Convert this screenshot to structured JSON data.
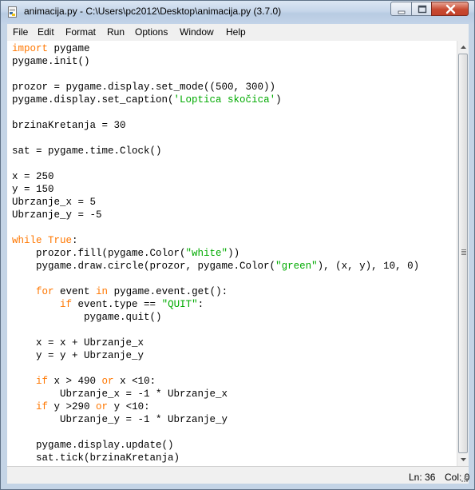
{
  "window": {
    "title": "animacija.py - C:\\Users\\pc2012\\Desktop\\animacija.py (3.7.0)",
    "icon": "python-file-icon"
  },
  "menu": {
    "items": [
      "File",
      "Edit",
      "Format",
      "Run",
      "Options",
      "Window",
      "Help"
    ]
  },
  "status": {
    "line": "Ln: 36",
    "col": "Col: 0"
  },
  "colors": {
    "keyword": "#ff7700",
    "builtin": "#900090",
    "string": "#00aa00",
    "text": "#000000"
  },
  "code": {
    "lines": [
      [
        [
          "kw",
          "import"
        ],
        [
          "t",
          " pygame"
        ]
      ],
      [
        [
          "t",
          "pygame.init()"
        ]
      ],
      [],
      [
        [
          "t",
          "prozor = pygame.display.set_mode((500, 300))"
        ]
      ],
      [
        [
          "t",
          "pygame.display.set_caption("
        ],
        [
          "str",
          "'Loptica skočica'"
        ],
        [
          "t",
          ")"
        ]
      ],
      [],
      [
        [
          "t",
          "brzinaKretanja = 30"
        ]
      ],
      [],
      [
        [
          "t",
          "sat = pygame.time.Clock()"
        ]
      ],
      [],
      [
        [
          "t",
          "x = 250"
        ]
      ],
      [
        [
          "t",
          "y = 150"
        ]
      ],
      [
        [
          "t",
          "Ubrzanje_x = 5"
        ]
      ],
      [
        [
          "t",
          "Ubrzanje_y = -5"
        ]
      ],
      [],
      [
        [
          "kw",
          "while"
        ],
        [
          "t",
          " "
        ],
        [
          "kw",
          "True"
        ],
        [
          "t",
          ":"
        ]
      ],
      [
        [
          "t",
          "    prozor.fill(pygame.Color("
        ],
        [
          "str",
          "\"white\""
        ],
        [
          "t",
          "))"
        ]
      ],
      [
        [
          "t",
          "    pygame.draw.circle(prozor, pygame.Color("
        ],
        [
          "str",
          "\"green\""
        ],
        [
          "t",
          "), (x, y), 10, 0)"
        ]
      ],
      [],
      [
        [
          "t",
          "    "
        ],
        [
          "kw",
          "for"
        ],
        [
          "t",
          " event "
        ],
        [
          "kw",
          "in"
        ],
        [
          "t",
          " pygame.event.get():"
        ]
      ],
      [
        [
          "t",
          "        "
        ],
        [
          "kw",
          "if"
        ],
        [
          "t",
          " event.type == "
        ],
        [
          "str",
          "\"QUIT\""
        ],
        [
          "t",
          ":"
        ]
      ],
      [
        [
          "t",
          "            pygame.quit()"
        ]
      ],
      [],
      [
        [
          "t",
          "    x = x + Ubrzanje_x"
        ]
      ],
      [
        [
          "t",
          "    y = y + Ubrzanje_y"
        ]
      ],
      [],
      [
        [
          "t",
          "    "
        ],
        [
          "kw",
          "if"
        ],
        [
          "t",
          " x > 490 "
        ],
        [
          "kw",
          "or"
        ],
        [
          "t",
          " x <10:"
        ]
      ],
      [
        [
          "t",
          "        Ubrzanje_x = -1 * Ubrzanje_x"
        ]
      ],
      [
        [
          "t",
          "    "
        ],
        [
          "kw",
          "if"
        ],
        [
          "t",
          " y >290 "
        ],
        [
          "kw",
          "or"
        ],
        [
          "t",
          " y <10:"
        ]
      ],
      [
        [
          "t",
          "        Ubrzanje_y = -1 * Ubrzanje_y"
        ]
      ],
      [],
      [
        [
          "t",
          "    pygame.display.update()"
        ]
      ],
      [
        [
          "t",
          "    sat.tick(brzinaKretanja)"
        ]
      ]
    ]
  }
}
